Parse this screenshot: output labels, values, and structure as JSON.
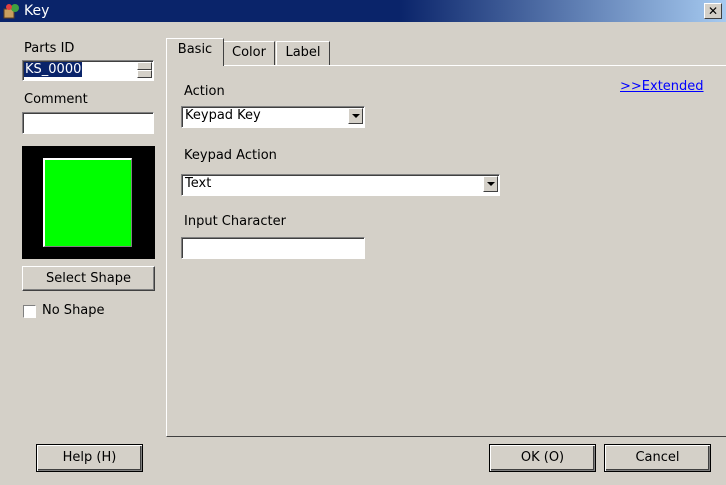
{
  "window": {
    "title": "Key",
    "close_glyph": "✕"
  },
  "left": {
    "parts_id_label": "Parts ID",
    "parts_id_value": "KS_0000",
    "comment_label": "Comment",
    "comment_value": "",
    "select_shape_label": "Select Shape",
    "no_shape_label": "No Shape",
    "no_shape_checked": false,
    "shape_color": "#00ff00"
  },
  "tabs": [
    {
      "label": "Basic",
      "active": true
    },
    {
      "label": "Color",
      "active": false
    },
    {
      "label": "Label",
      "active": false
    }
  ],
  "basic": {
    "extended_link": ">>Extended",
    "action_label": "Action",
    "action_value": "Keypad Key",
    "keypad_action_label": "Keypad Action",
    "keypad_action_value": "Text",
    "input_character_label": "Input Character",
    "input_character_value": ""
  },
  "footer": {
    "help_label": "Help (H)",
    "ok_label": "OK (O)",
    "cancel_label": "Cancel"
  },
  "colors": {
    "title_bar": "#0a246a",
    "face": "#d4d0c8",
    "link": "#0000ff"
  }
}
